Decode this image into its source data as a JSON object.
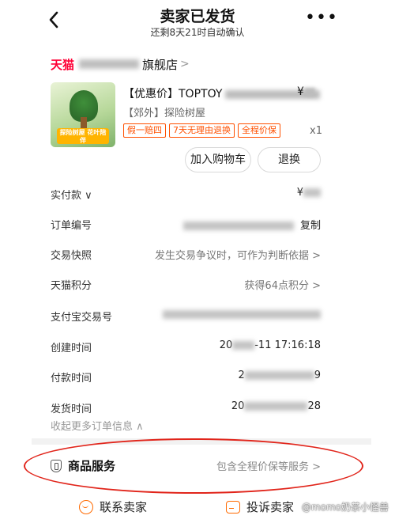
{
  "header": {
    "back_icon": "chevron-left-icon",
    "title": "卖家已发货",
    "subtitle": "还剩8天21时自动确认",
    "more_icon": "more-dots-icon",
    "more_label": "•••"
  },
  "shop": {
    "platform": "天猫",
    "name_suffix": "旗舰店",
    "chevron": ">"
  },
  "product": {
    "title_prefix": "【优惠价】TOPTOY",
    "price_prefix": "¥",
    "sku": "【郊外】探险树屋",
    "badges": [
      "假一赔四",
      "7天无理由退换",
      "全程价保"
    ],
    "qty": "x1",
    "thumb_tag": "探险树屋 花叶陪伴",
    "buttons": {
      "add_to_cart": "加入购物车",
      "refund": "退换"
    }
  },
  "details": {
    "paid_label": "实付款 ∨",
    "paid_value_prefix": "¥",
    "order_no_label": "订单编号",
    "copy_label": "复制",
    "snapshot_label": "交易快照",
    "snapshot_value": "发生交易争议时，可作为判断依据 >",
    "points_label": "天猫积分",
    "points_value": "获得64点积分 >",
    "alipay_label": "支付宝交易号",
    "created_label": "创建时间",
    "created_value_tail": "-11 17:16:18",
    "created_value_head": "20",
    "paid_time_label": "付款时间",
    "paid_time_head": "2",
    "paid_time_tail": "9",
    "ship_time_label": "发货时间",
    "ship_time_head": "20",
    "ship_time_tail": "28",
    "collapse_label": "收起更多订单信息 ∧"
  },
  "service": {
    "icon": "shield-icon",
    "label": "商品服务",
    "value": "包含全程价保等服务 >"
  },
  "footer": {
    "contact_label": "联系卖家",
    "complain_label": "投诉卖家",
    "watermark": "@momo奶茶小怪兽"
  },
  "colors": {
    "accent": "#ff5000",
    "tmall_red": "#ff0036",
    "annotation_red": "#e1251b"
  }
}
